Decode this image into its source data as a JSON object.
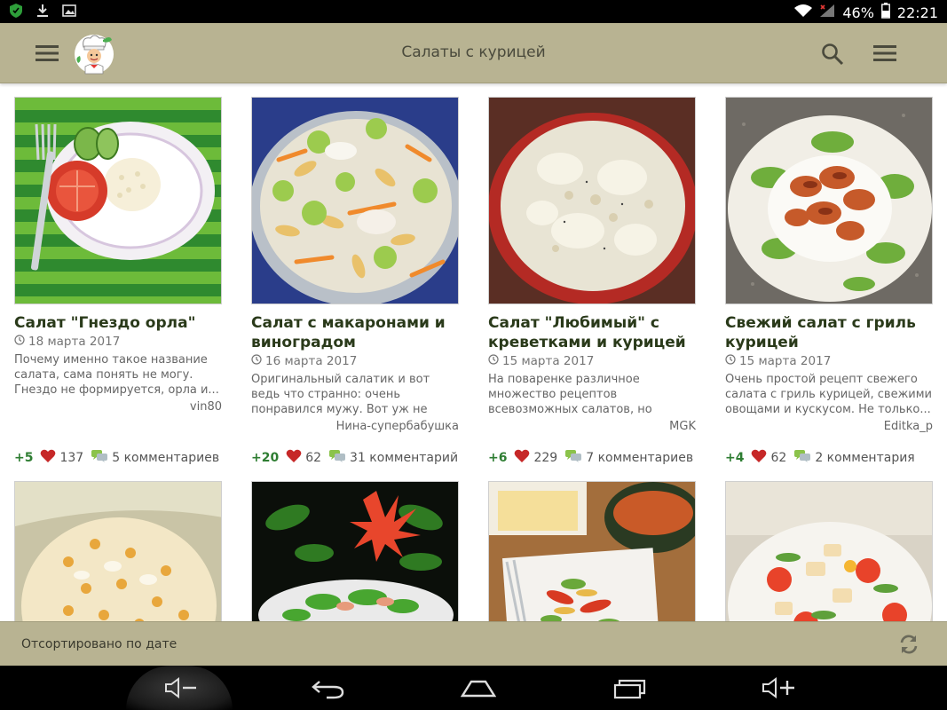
{
  "status_bar": {
    "battery": "46%",
    "time": "22:21",
    "icons": [
      "shield-icon",
      "download-icon",
      "image-icon",
      "wifi-icon",
      "signal-icon",
      "battery-icon"
    ]
  },
  "toolbar": {
    "title": "Салаты с курицей",
    "icons": [
      "menu-icon",
      "chef-logo-icon",
      "search-icon",
      "overflow-menu-icon"
    ]
  },
  "recipes": [
    {
      "title": "Салат \"Гнездо орла\"",
      "date": "18 марта 2017",
      "description": "Почему именно такое название салата, сама понять не могу. Гнездо не формируется, орла и...",
      "author": "vin80",
      "score": "+5",
      "likes": "137",
      "comments": "5 комментариев"
    },
    {
      "title": "Салат с макаронами и виноградом",
      "date": "16 марта 2017",
      "description": "Оригинальный салатик и вот ведь что странно: очень понравился мужу. Вот уж не ожидала. Рецепт...",
      "author": "Нина-супербабушка",
      "score": "+20",
      "likes": "62",
      "comments": "31 комментарий"
    },
    {
      "title": "Салат \"Любимый\" с креветками и курицей",
      "date": "15 марта 2017",
      "description": "На поваренке различное множество рецептов всевозможных салатов, но точно...",
      "author": "MGK",
      "score": "+6",
      "likes": "229",
      "comments": "7 комментариев"
    },
    {
      "title": "Свежий салат с гриль курицей",
      "date": "15 марта 2017",
      "description": "Очень простой рецепт свежего салата с гриль курицей, свежими овощами и кускусом. Не только...",
      "author": "Editka_p",
      "score": "+4",
      "likes": "62",
      "comments": "2 комментария"
    }
  ],
  "sort_bar": {
    "label": "Отсортировано по дате"
  },
  "colors": {
    "toolbar_bg": "#b8b392",
    "title_text": "#2a3a1a",
    "score_green": "#2e7d32",
    "heart_red": "#c62828"
  }
}
